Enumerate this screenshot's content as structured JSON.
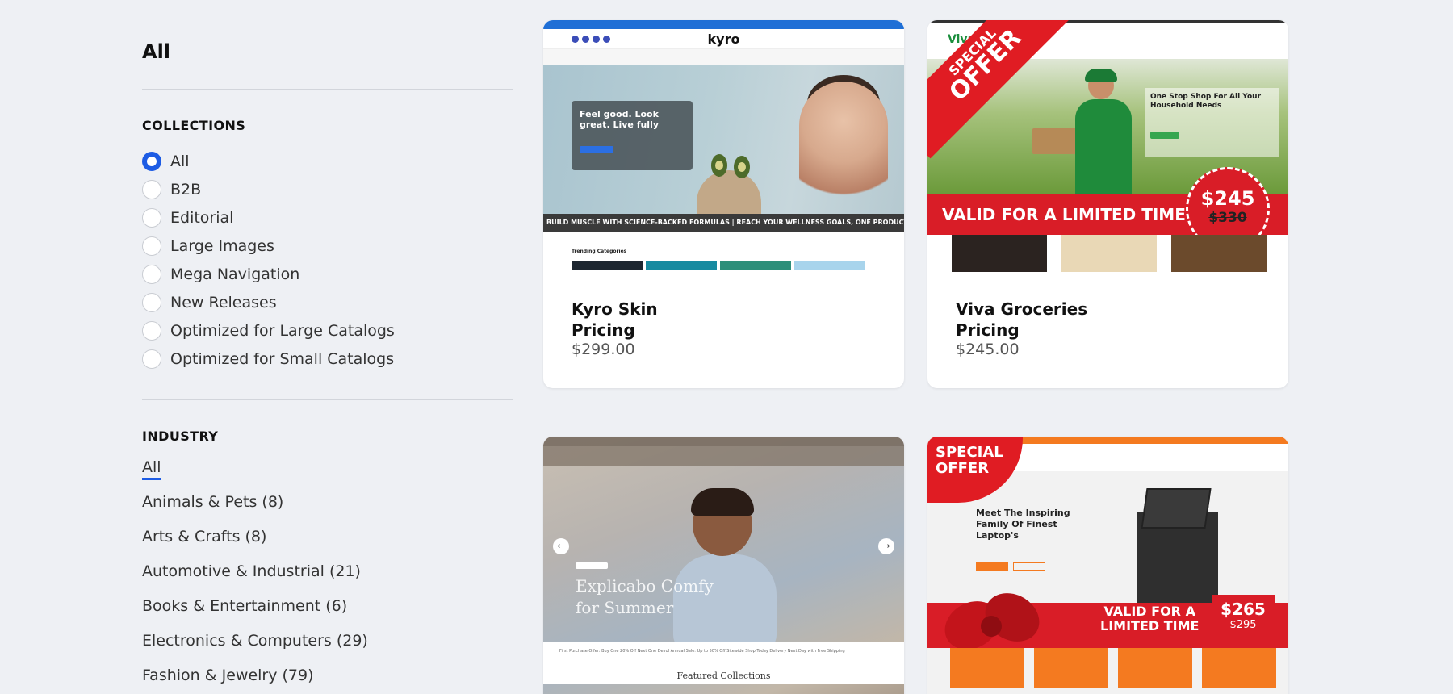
{
  "sidebar": {
    "page_title": "All",
    "collections": {
      "title": "COLLECTIONS",
      "items": [
        {
          "label": "All",
          "selected": true
        },
        {
          "label": "B2B",
          "selected": false
        },
        {
          "label": "Editorial",
          "selected": false
        },
        {
          "label": "Large Images",
          "selected": false
        },
        {
          "label": "Mega Navigation",
          "selected": false
        },
        {
          "label": "New Releases",
          "selected": false
        },
        {
          "label": "Optimized for Large Catalogs",
          "selected": false
        },
        {
          "label": "Optimized for Small Catalogs",
          "selected": false
        }
      ]
    },
    "industry": {
      "title": "INDUSTRY",
      "items": [
        {
          "label": "All",
          "active": true
        },
        {
          "label": "Animals & Pets (8)"
        },
        {
          "label": "Arts & Crafts (8)"
        },
        {
          "label": "Automotive & Industrial (21)"
        },
        {
          "label": "Books & Entertainment (6)"
        },
        {
          "label": "Electronics & Computers (29)"
        },
        {
          "label": "Fashion & Jewelry (79)"
        }
      ]
    }
  },
  "products": [
    {
      "name_line1": "Kyro Skin",
      "name_line2": "Pricing",
      "price": "$299.00",
      "preview": {
        "logo": "kyro",
        "hero_heading": "Feel good. Look great. Live fully",
        "ticker": "BUILD MUSCLE WITH SCIENCE-BACKED FORMULAS | REACH YOUR WELLNESS GOALS, ONE PRODUCT AT A TIME | BUILD MUS",
        "section_label": "Trending Categories"
      }
    },
    {
      "name_line1": "Viva Groceries",
      "name_line2": "Pricing",
      "price": "$245.00",
      "preview": {
        "logo": "Viva",
        "hero_heading": "One Stop Shop For All Your Household Needs",
        "offer_top": "SPECIAL",
        "offer_main": "OFFER",
        "band_text": "VALID FOR A LIMITED TIME",
        "badge_price": "$245",
        "badge_old_price": "$330"
      }
    },
    {
      "preview": {
        "hero_line1": "Explicabo Comfy",
        "hero_line2": "for Summer",
        "promo": "First Purchase Offer: Buy One 20% Off Next One      Devol Annual Sale: Up to 50% Off Sitewide      Shop Today Delivery Next Day with Free Shipping",
        "section_label": "Featured Collections"
      }
    },
    {
      "preview": {
        "offer_line1": "SPECIAL",
        "offer_line2": "OFFER",
        "hero_heading": "Meet The Inspiring Family Of Finest Laptop's",
        "valid_line1": "VALID FOR A",
        "valid_line2": "LIMITED TIME",
        "badge_price": "$265",
        "badge_old_price": "$295"
      }
    }
  ],
  "colors": {
    "accent": "#1d5ce4",
    "background": "#eef0f4",
    "offer_red": "#d91d27",
    "orange": "#f47a20"
  }
}
